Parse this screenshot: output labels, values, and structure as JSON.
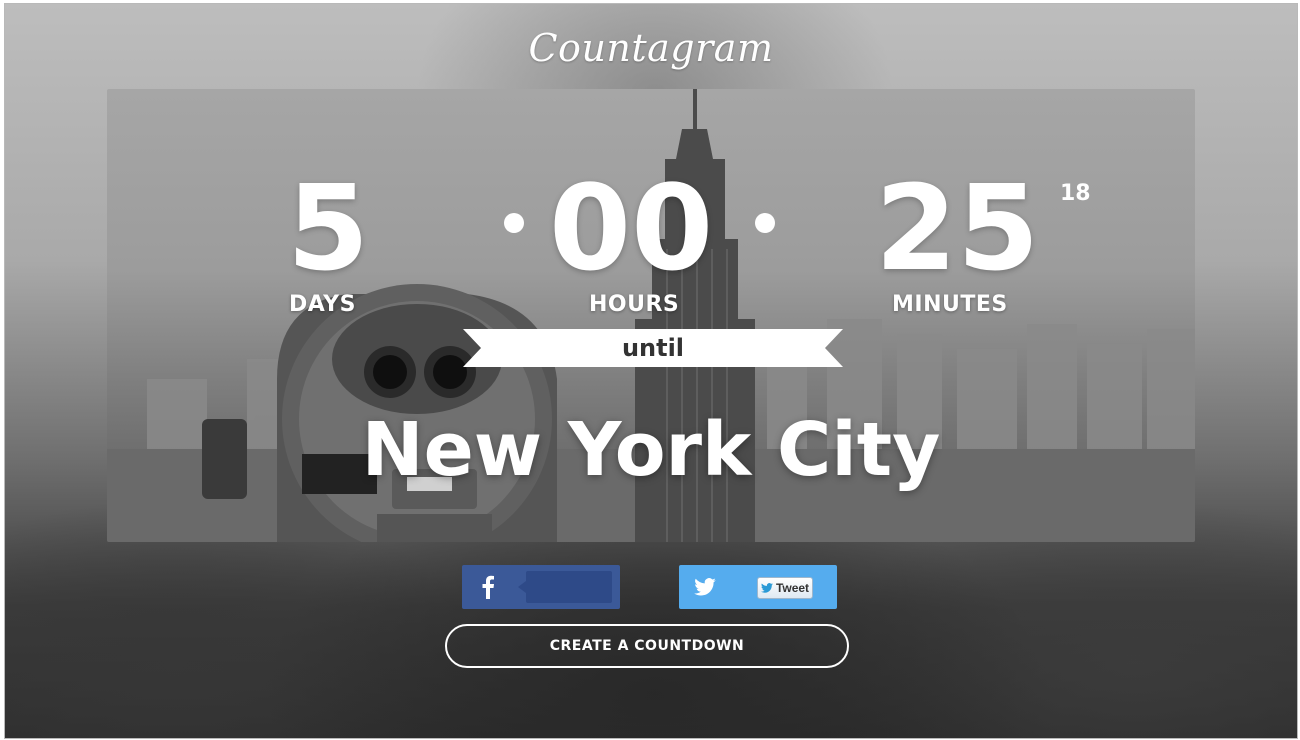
{
  "brand": {
    "logo": "Countagram"
  },
  "countdown": {
    "days": {
      "value": "5",
      "label": "DAYS"
    },
    "hours": {
      "value": "00",
      "label": "HOURS"
    },
    "minutes": {
      "value": "25",
      "label": "MINUTES"
    },
    "seconds": {
      "value": "18"
    },
    "until_label": "until",
    "event_name": "New York City"
  },
  "share": {
    "facebook": {
      "icon": "facebook-icon",
      "color": "#3b5998"
    },
    "twitter": {
      "icon": "twitter-icon",
      "color": "#55acee",
      "tweet_label": "Tweet"
    }
  },
  "cta": {
    "label": "CREATE A COUNTDOWN"
  }
}
